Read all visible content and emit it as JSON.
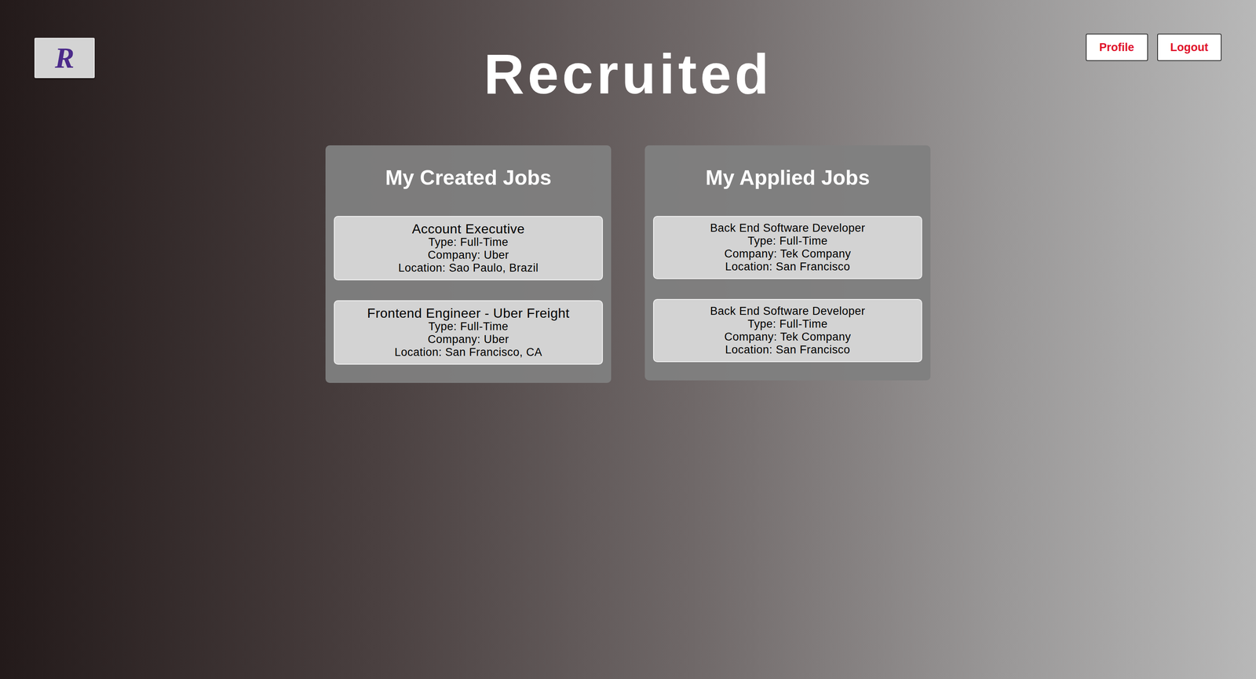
{
  "header": {
    "logo": "R",
    "title": "Recruited"
  },
  "nav": [
    {
      "label": "Profile"
    },
    {
      "label": "Logout"
    }
  ],
  "sections": [
    {
      "title": "My Created Jobs",
      "jobs": [
        {
          "title": "Account Executive",
          "type": "Type: Full-Time",
          "company": "Company: Uber",
          "location": "Location: Sao Paulo, Brazil"
        },
        {
          "title": "Frontend Engineer - Uber Freight",
          "type": "Type: Full-Time",
          "company": "Company: Uber",
          "location": "Location: San Francisco, CA"
        }
      ]
    },
    {
      "title": "My Applied Jobs",
      "jobs": [
        {
          "title": "Back End Software Developer",
          "type": "Type: Full-Time",
          "company": "Company: Tek Company",
          "location": "Location: San Francisco"
        },
        {
          "title": "Back End Software Developer",
          "type": "Type: Full-Time",
          "company": "Company: Tek Company",
          "location": "Location: San Francisco"
        }
      ]
    }
  ]
}
